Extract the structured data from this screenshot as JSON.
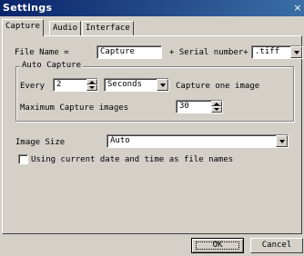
{
  "window": {
    "title": "Settings",
    "close_glyph": "×"
  },
  "tabs": [
    {
      "label": "Capture",
      "active": true
    },
    {
      "label": "Audio",
      "active": false
    },
    {
      "label": "Interface",
      "active": false
    }
  ],
  "capture": {
    "file_name_label": "File Name =",
    "file_name_value": "Capture",
    "serial_label": "+ Serial number+",
    "extension_value": ".tiff",
    "auto_capture": {
      "title": "Auto Capture",
      "every_label": "Every",
      "every_value": "2",
      "unit_value": "Seconds",
      "capture_one_label": "Capture one image",
      "max_label": "Maximum Capture images",
      "max_value": "30"
    },
    "image_size_label": "Image Size",
    "image_size_value": "Auto",
    "use_date_label": "Using current date and time as file names",
    "use_date_checked": false
  },
  "buttons": {
    "ok": "OK",
    "cancel": "Cancel"
  }
}
